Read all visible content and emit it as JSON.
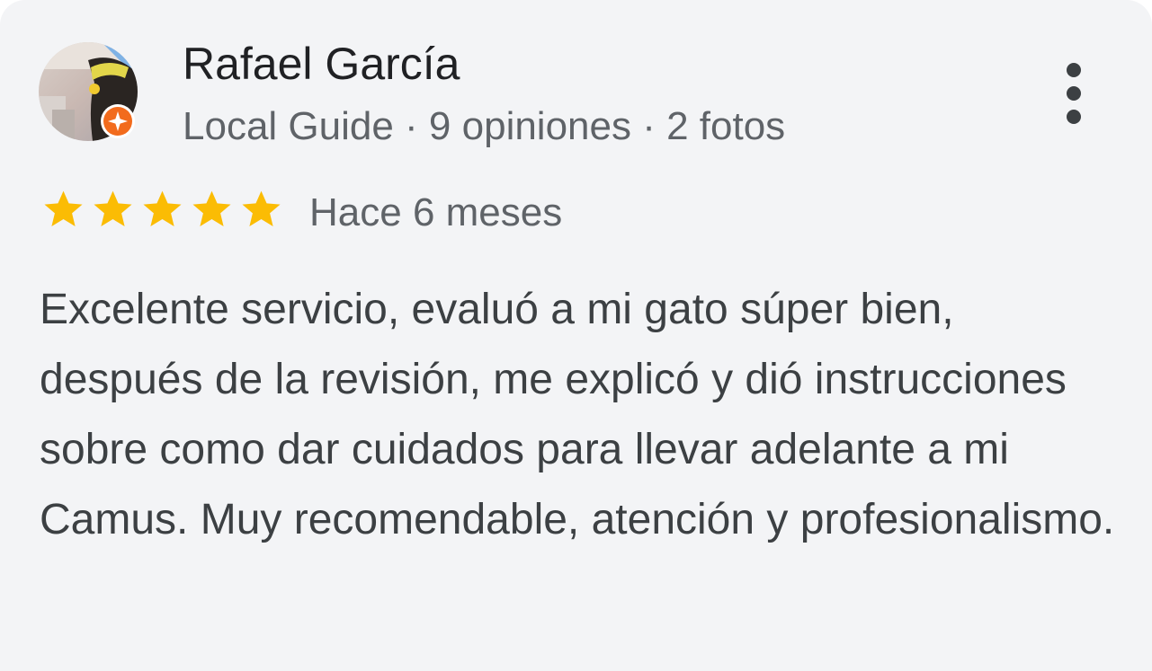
{
  "review": {
    "author": {
      "name": "Rafael García",
      "meta": "Local Guide · 9 opiniones · 2 fotos",
      "avatar_icon": "user-avatar-photo",
      "badge_icon": "local-guide-star-badge",
      "badge_color": "#f26b1d"
    },
    "rating": {
      "value": 5,
      "max": 5,
      "star_color": "#fbbc04"
    },
    "date": "Hace 6 meses",
    "text": "Excelente servicio, evaluó a mi gato súper bien, después de la revisión, me explicó y dió instrucciones sobre como dar cuidados para llevar adelante a mi Camus. Muy recomendable, atención y profesionalismo.",
    "more_icon": "more-vertical-icon"
  }
}
